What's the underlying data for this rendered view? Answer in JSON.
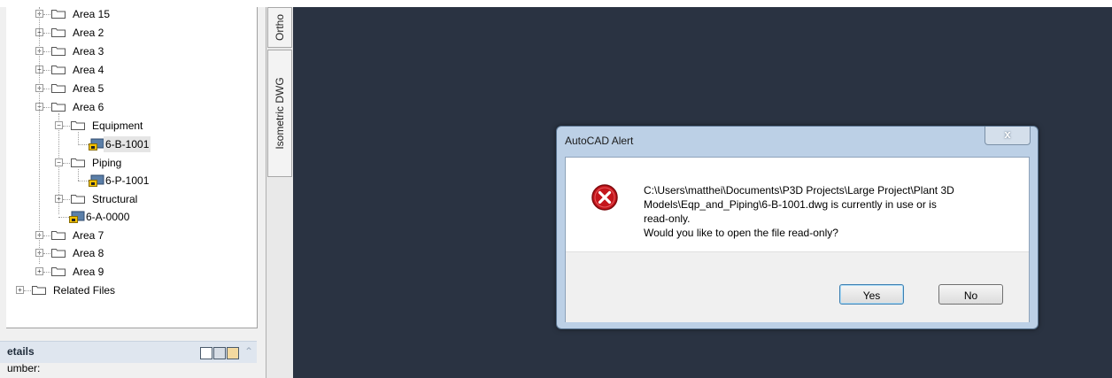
{
  "tree": {
    "items": [
      {
        "label": "Area 15"
      },
      {
        "label": "Area 2"
      },
      {
        "label": "Area 3"
      },
      {
        "label": "Area 4"
      },
      {
        "label": "Area 5"
      },
      {
        "label": "Area 6"
      },
      {
        "label": "Equipment"
      },
      {
        "label": "6-B-1001"
      },
      {
        "label": "Piping"
      },
      {
        "label": "6-P-1001"
      },
      {
        "label": "Structural"
      },
      {
        "label": "6-A-0000"
      },
      {
        "label": "Area 7"
      },
      {
        "label": "Area 8"
      },
      {
        "label": "Area 9"
      },
      {
        "label": "Related Files"
      }
    ]
  },
  "details": {
    "title": "etails",
    "number_label": "umber:"
  },
  "tabs": {
    "ortho": "Ortho",
    "isometric": "Isometric DWG"
  },
  "dialog": {
    "title": "AutoCAD Alert",
    "close": "x",
    "message_lines": [
      "C:\\Users\\matthei\\Documents\\P3D Projects\\Large Project\\Plant 3D",
      "Models\\Eqp_and_Piping\\6-B-1001.dwg is currently in use or is",
      "read-only.",
      "Would you like to open the file read-only?"
    ],
    "yes_label": "Yes",
    "no_label": "No"
  },
  "colors": {
    "canvas": "#2a3342",
    "dialog_frame": "#bcd0e6",
    "error_red": "#c4161c"
  }
}
